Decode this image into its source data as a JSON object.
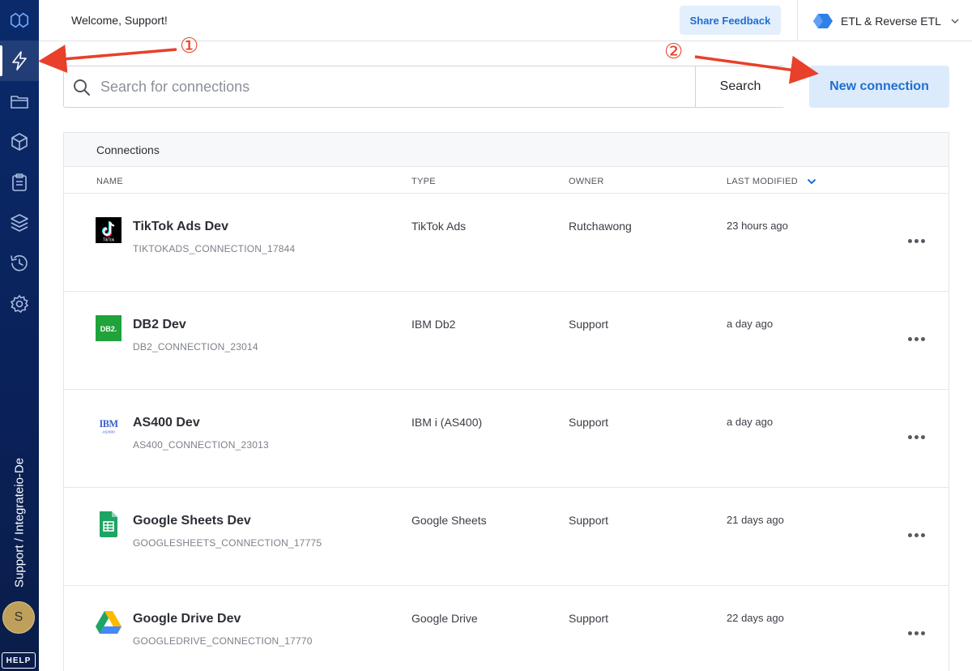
{
  "header": {
    "welcome": "Welcome, Support!",
    "feedback_label": "Share Feedback",
    "product_label": "ETL & Reverse ETL"
  },
  "sidebar": {
    "items": [
      {
        "icon": "integrate-logo-icon"
      },
      {
        "icon": "lightning-icon",
        "active": true
      },
      {
        "icon": "folder-icon"
      },
      {
        "icon": "package-icon"
      },
      {
        "icon": "clipboard-icon"
      },
      {
        "icon": "layers-icon"
      },
      {
        "icon": "history-icon"
      },
      {
        "icon": "gear-icon"
      }
    ],
    "workspace": "Support / Integrateio-De",
    "avatar_initial": "S",
    "help_label": "HELP"
  },
  "search": {
    "placeholder": "Search for connections",
    "value": "",
    "button_label": "Search"
  },
  "new_connection_label": "New connection",
  "table": {
    "title": "Connections",
    "columns": [
      "NAME",
      "TYPE",
      "OWNER",
      "LAST MODIFIED"
    ],
    "rows": [
      {
        "name": "TikTok Ads Dev",
        "id": "TIKTOKADS_CONNECTION_17844",
        "type": "TikTok Ads",
        "owner": "Rutchawong",
        "modified": "23 hours ago",
        "logo": "tiktok-logo-icon",
        "logo_text": "TikTok"
      },
      {
        "name": "DB2 Dev",
        "id": "DB2_CONNECTION_23014",
        "type": "IBM Db2",
        "owner": "Support",
        "modified": "a day ago",
        "logo": "db2-logo-icon",
        "logo_text": "DB2."
      },
      {
        "name": "AS400 Dev",
        "id": "AS400_CONNECTION_23013",
        "type": "IBM i (AS400)",
        "owner": "Support",
        "modified": "a day ago",
        "logo": "ibm-logo-icon",
        "logo_text": "IBM",
        "logo_subtext": "AS/400"
      },
      {
        "name": "Google Sheets Dev",
        "id": "GOOGLESHEETS_CONNECTION_17775",
        "type": "Google Sheets",
        "owner": "Support",
        "modified": "21 days ago",
        "logo": "google-sheets-logo-icon"
      },
      {
        "name": "Google Drive Dev",
        "id": "GOOGLEDRIVE_CONNECTION_17770",
        "type": "Google Drive",
        "owner": "Support",
        "modified": "22 days ago",
        "logo": "google-drive-logo-icon"
      }
    ]
  },
  "annotations": {
    "step1": "①",
    "step2": "②",
    "color": "#e8402a"
  },
  "colors": {
    "sidebar": "#0a2a6b",
    "accent": "#1f6ed4",
    "accent_bg": "#dcebfb"
  }
}
